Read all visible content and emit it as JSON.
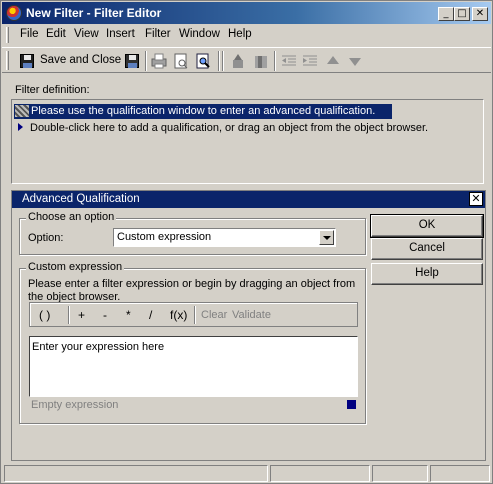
{
  "window": {
    "title": "New Filter - Filter Editor",
    "controls": {
      "minimize": "_",
      "maximize": "□",
      "close": "✕"
    }
  },
  "menu": {
    "items": [
      {
        "label": "File"
      },
      {
        "label": "Edit"
      },
      {
        "label": "View"
      },
      {
        "label": "Insert"
      },
      {
        "label": "Filter"
      },
      {
        "label": "Window"
      },
      {
        "label": "Help"
      }
    ]
  },
  "toolbar": {
    "save_close_label": "Save and Close",
    "icons": [
      "save-close-icon",
      "save-icon",
      "print-icon",
      "print-preview-icon",
      "find-icon",
      "move-up-level-icon",
      "move-down-level-icon",
      "outdent-icon",
      "indent-icon",
      "move-up-icon",
      "move-down-icon"
    ]
  },
  "filter_definition": {
    "label": "Filter definition:",
    "rows": [
      "Please use the qualification window to enter an advanced qualification.",
      "Double-click here to add a qualification, or drag an object from the object browser."
    ]
  },
  "advanced_qualification": {
    "title": "Advanced Qualification",
    "choose_option": {
      "legend": "Choose an option",
      "option_label": "Option:",
      "selected": "Custom expression"
    },
    "custom_expression": {
      "legend": "Custom expression",
      "instructions": "Please enter a filter expression or begin by dragging an object from the object browser.",
      "operators": [
        "( )",
        "+",
        "-",
        "*",
        "/",
        "f(x)"
      ],
      "clear_label": "Clear",
      "validate_label": "Validate",
      "editor_text": "Enter your expression here",
      "status": "Empty expression"
    },
    "buttons": {
      "ok": "OK",
      "cancel": "Cancel",
      "help": "Help"
    }
  },
  "colors": {
    "titlebar": "#0a246a",
    "selection": "#0a246a",
    "face": "#d4d0c8"
  }
}
